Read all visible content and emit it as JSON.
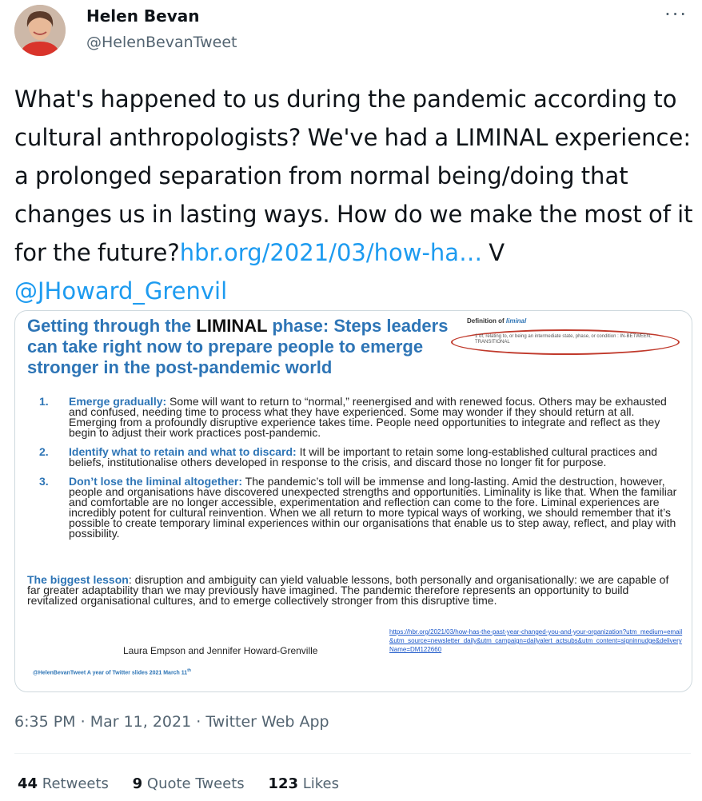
{
  "author": {
    "name": "Helen Bevan",
    "handle": "@HelenBevanTweet"
  },
  "more_label": "···",
  "tweet": {
    "text": "What's happened to us during the pandemic according to cultural anthropologists? We've had a LIMINAL experience: a prolonged separation from normal being/doing that changes us in lasting ways. How do we make the most of it for the future?",
    "link": "hbr.org/2021/03/how-ha…",
    "connector": " V ",
    "mention": "@JHoward_Grenvil"
  },
  "slide": {
    "title_part1": "Getting through the ",
    "title_liminal": "LIMINAL",
    "title_part2": " phase: Steps leaders can take right now to prepare people to emerge stronger in the post-pandemic world",
    "definition_title": "Definition of ",
    "definition_word": "liminal",
    "definition_text": "1 of, relating to, or being an intermediate state, phase, or condition : IN-BETWEEN, TRANSITIONAL",
    "items": [
      {
        "num": "1.",
        "head": "Emerge gradually:",
        "text": " Some will want to return to “normal,” reenergised and with renewed focus. Others may be exhausted and confused, needing time to process what they have experienced. Some may wonder if they should return at all. Emerging from a profoundly disruptive experience takes time. People need opportunities to integrate and reflect as they begin to adjust their work practices post-pandemic."
      },
      {
        "num": "2.",
        "head": "Identify what to retain and what to discard:",
        "text": " It will be important to retain some long-established cultural practices and beliefs, institutionalise others developed in response to the crisis, and discard those no longer fit for purpose."
      },
      {
        "num": "3.",
        "head": "Don’t lose the liminal altogether:",
        "text": " The pandemic’s toll will be immense and long-lasting. Amid the destruction, however, people and organisations have discovered unexpected strengths and opportunities. Liminality is like that. When the familiar and comfortable are no longer accessible, experimentation and reflection can come to the fore. Liminal experiences are incredibly potent for cultural reinvention. When we all return to more typical ways of working, we should remember that it’s possible to create temporary liminal experiences within our organisations that enable us to step away, reflect, and play with possibility."
      }
    ],
    "lesson_head": "The biggest lesson",
    "lesson_text": ": disruption and ambiguity can yield valuable lessons, both personally and organisationally: we are capable of far greater adaptability than we may previously have imagined. The pandemic therefore represents an opportunity to build revitalized organisational cultures, and to emerge collectively stronger from this disruptive time.",
    "authors": "Laura Empson and Jennifer Howard-Grenville",
    "source_url": "https://hbr.org/2021/03/how-has-the-past-year-changed-you-and-your-organization?utm_medium=email&utm_source=newsletter_daily&utm_campaign=dailyalert_actsubs&utm_content=signinnudge&deliveryName=DM122660",
    "footer_note": "@HelenBevanTweet A year of Twitter slides 2021 March 11",
    "footer_sup": "th"
  },
  "meta": {
    "time": "6:35 PM",
    "date": "Mar 11, 2021",
    "source": "Twitter Web App",
    "sep": " · "
  },
  "stats": {
    "retweets_count": "44",
    "retweets_label": " Retweets",
    "quotes_count": "9",
    "quotes_label": " Quote Tweets",
    "likes_count": "123",
    "likes_label": " Likes"
  },
  "colors": {
    "link": "#1d9bf0",
    "slide_blue": "#2e75b6",
    "muted": "#536471"
  }
}
